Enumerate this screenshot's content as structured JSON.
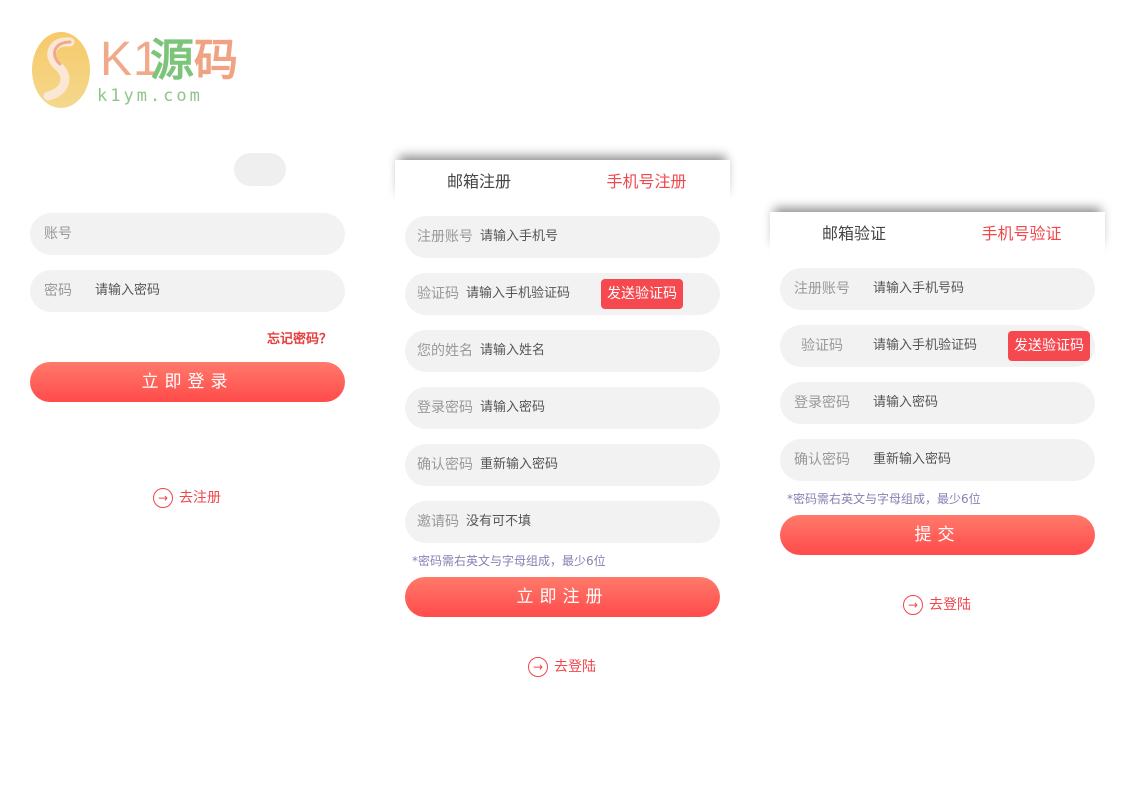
{
  "logo": {
    "k1": "K1",
    "zh1": "源",
    "zh2": "码",
    "domain": "k1ym.com"
  },
  "login": {
    "account_label": "账号",
    "password_label": "密码",
    "password_placeholder": "请输入密码",
    "forgot": "忘记密码？",
    "submit": "立即登录",
    "go_register": "去注册",
    "go_icon": "→"
  },
  "register": {
    "tab_email": "邮箱注册",
    "tab_phone": "手机号注册",
    "fields": [
      {
        "label": "注册账号",
        "placeholder": "请输入手机号"
      },
      {
        "label": "验证码",
        "placeholder": "请输入手机验证码"
      },
      {
        "label": "您的姓名",
        "placeholder": "请输入姓名"
      },
      {
        "label": "登录密码",
        "placeholder": "请输入密码"
      },
      {
        "label": "确认密码",
        "placeholder": "重新输入密码"
      },
      {
        "label": "邀请码",
        "placeholder": "没有可不填"
      }
    ],
    "send_code": "发送验证码",
    "note": "*密码需右英文与字母组成，最少6位",
    "submit": "立即注册",
    "go_login": "去登陆",
    "go_icon": "→"
  },
  "verify": {
    "tab_email": "邮箱验证",
    "tab_phone": "手机号验证",
    "fields": [
      {
        "label": "注册账号",
        "placeholder": "请输入手机号码"
      },
      {
        "label": "验证码",
        "placeholder": "请输入手机验证码"
      },
      {
        "label": "登录密码",
        "placeholder": "请输入密码"
      },
      {
        "label": "确认密码",
        "placeholder": "重新输入密码"
      }
    ],
    "send_code": "发送验证码",
    "note": "*密码需右英文与字母组成，最少6位",
    "submit": "提交",
    "go_login": "去登陆",
    "go_icon": "→"
  },
  "colors": {
    "accent": "#f0474c",
    "field_bg": "#f2f2f2",
    "button_top": "#ff7a6a",
    "button_bottom": "#ff4b4b"
  }
}
